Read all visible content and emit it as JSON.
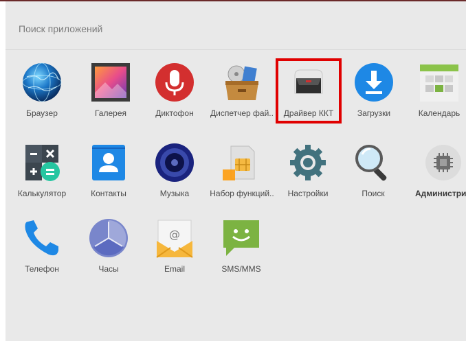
{
  "search": {
    "placeholder": "Поиск приложений"
  },
  "apps": [
    {
      "label": "Браузер",
      "icon": "globe-icon"
    },
    {
      "label": "Галерея",
      "icon": "gallery-icon"
    },
    {
      "label": "Диктофон",
      "icon": "microphone-icon"
    },
    {
      "label": "Диспетчер фай..",
      "icon": "file-manager-icon"
    },
    {
      "label": "Драйвер ККТ",
      "icon": "kkt-driver-icon"
    },
    {
      "label": "Загрузки",
      "icon": "download-icon"
    },
    {
      "label": "Календарь",
      "icon": "calendar-icon"
    },
    {
      "label": "Калькулятор",
      "icon": "calculator-icon"
    },
    {
      "label": "Контакты",
      "icon": "contacts-icon"
    },
    {
      "label": "Музыка",
      "icon": "music-speaker-icon"
    },
    {
      "label": "Набор функций..",
      "icon": "sim-toolkit-icon"
    },
    {
      "label": "Настройки",
      "icon": "gear-icon"
    },
    {
      "label": "Поиск",
      "icon": "magnifier-icon"
    },
    {
      "label": "Администрир",
      "icon": "chip-icon"
    },
    {
      "label": "Телефон",
      "icon": "phone-icon"
    },
    {
      "label": "Часы",
      "icon": "clock-icon"
    },
    {
      "label": "Email",
      "icon": "email-icon"
    },
    {
      "label": "SMS/MMS",
      "icon": "sms-icon"
    }
  ],
  "colors": {
    "highlight": "#e00000",
    "background": "#e9e9e9"
  }
}
